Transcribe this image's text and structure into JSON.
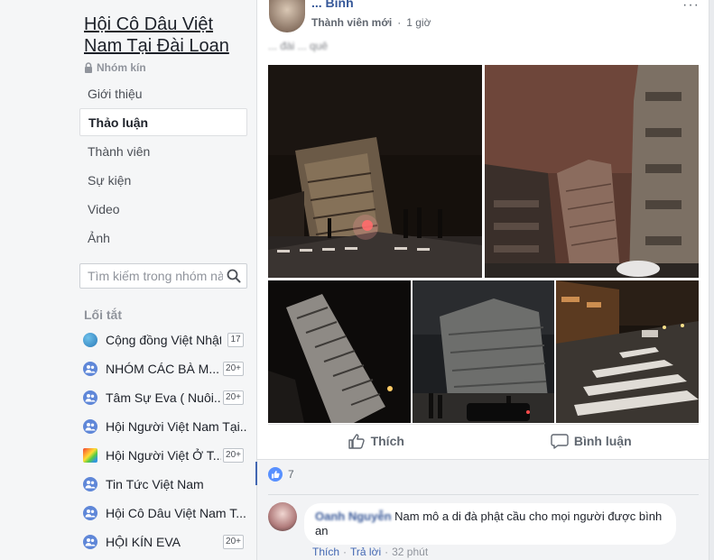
{
  "group": {
    "title": "Hội Cô Dâu Việt Nam Tại Đài Loan",
    "privacy": "Nhóm kín"
  },
  "nav": [
    {
      "label": "Giới thiệu",
      "active": false
    },
    {
      "label": "Thảo luận",
      "active": true
    },
    {
      "label": "Thành viên",
      "active": false
    },
    {
      "label": "Sự kiện",
      "active": false
    },
    {
      "label": "Video",
      "active": false
    },
    {
      "label": "Ảnh",
      "active": false
    }
  ],
  "search": {
    "placeholder": "Tìm kiếm trong nhóm này"
  },
  "shortcuts_title": "Lối tắt",
  "shortcuts": [
    {
      "label": "Cộng đồng Việt Nhật...",
      "icon": "globe-icon",
      "badge": "17"
    },
    {
      "label": "NHÓM CÁC BÀ M...",
      "icon": "group-icon",
      "badge": "20+"
    },
    {
      "label": "Tâm Sự Eva ( Nuôi...",
      "icon": "group-icon",
      "badge": "20+"
    },
    {
      "label": "Hội Người Việt Nam Tại...",
      "icon": "group-icon",
      "badge": ""
    },
    {
      "label": "Hội Người Việt Ở T...",
      "icon": "rainbow-icon",
      "badge": "20+"
    },
    {
      "label": "Tin Tức Việt Nam",
      "icon": "group-icon",
      "badge": ""
    },
    {
      "label": "Hội Cô Dâu Việt Nam T...",
      "icon": "group-icon",
      "badge": ""
    },
    {
      "label": "HỘI KÍN EVA",
      "icon": "group-icon",
      "badge": "20+"
    }
  ],
  "post": {
    "author": "... Bình",
    "role": "Thành viên mới",
    "time": "1 giờ",
    "text": "... đài ... quê",
    "more": "···"
  },
  "actions": {
    "like": "Thích",
    "comment": "Bình luận"
  },
  "reactions": {
    "count": "7"
  },
  "comment": {
    "name": "Oanh Nguyễn",
    "text": "Nam mô a di đà phật cầu cho mọi người được bình an",
    "like": "Thích",
    "reply": "Trả lời",
    "time": "32 phút",
    "sep": "·"
  },
  "colors": {
    "link": "#365899",
    "accent": "#4267b2",
    "like_blue": "#5890ff"
  }
}
